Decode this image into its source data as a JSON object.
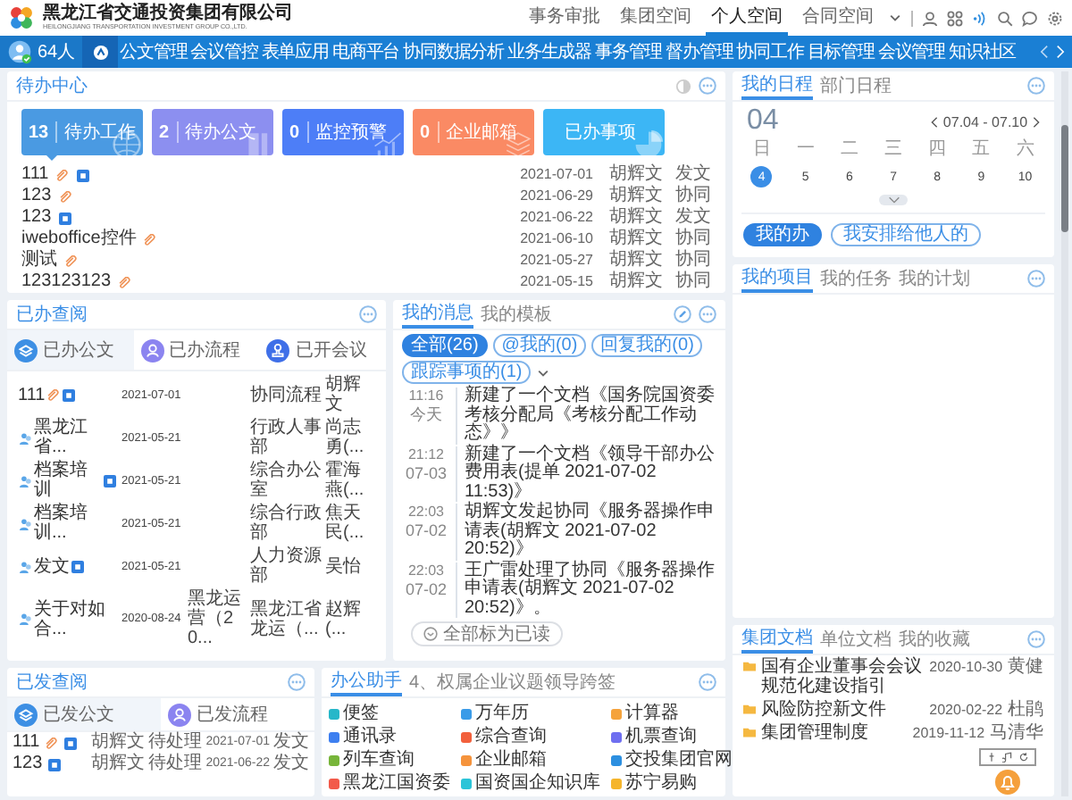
{
  "header": {
    "company": "黑龙江省交通投资集团有限公司",
    "company_en": "HEILONGJIANG TRANSPORTATION INVESTMENT GROUP CO.,LTD.",
    "links": [
      {
        "label": "事务审批",
        "selected": false
      },
      {
        "label": "集团空间",
        "selected": false
      },
      {
        "label": "个人空间",
        "selected": true
      },
      {
        "label": "合同空间",
        "selected": false
      }
    ]
  },
  "nav": {
    "online_count": "64人",
    "items": [
      "公文管理",
      "会议管控",
      "表单应用",
      "电商平台",
      "协同数据分析",
      "业务生成器",
      "事务管理",
      "督办管理",
      "协同工作",
      "目标管理",
      "会议管理",
      "知识社区"
    ]
  },
  "todo": {
    "title": "待办中心",
    "tiles": [
      {
        "count": "13",
        "label": "待办工作",
        "color": "#4a9ae2",
        "selected": true
      },
      {
        "count": "2",
        "label": "待办公文",
        "color": "#8c8ff0",
        "selected": false
      },
      {
        "count": "0",
        "label": "监控预警",
        "color": "#4d7ef7",
        "selected": false
      },
      {
        "count": "0",
        "label": "企业邮箱",
        "color": "#fa8a64",
        "selected": false
      },
      {
        "label": "已办事项",
        "color": "#3cb6f5",
        "selected": false
      }
    ],
    "rows": [
      {
        "title": "111",
        "attachment": true,
        "doc": true,
        "date": "2021-07-01",
        "person": "胡辉文",
        "type": "发文"
      },
      {
        "title": "123",
        "attachment": true,
        "doc": false,
        "date": "2021-06-29",
        "person": "胡辉文",
        "type": "协同"
      },
      {
        "title": "123",
        "attachment": false,
        "doc": true,
        "date": "2021-06-22",
        "person": "胡辉文",
        "type": "发文"
      },
      {
        "title": "iweboffice控件",
        "attachment": true,
        "doc": false,
        "date": "2021-06-10",
        "person": "胡辉文",
        "type": "协同"
      },
      {
        "title": "测试",
        "attachment": true,
        "doc": false,
        "date": "2021-05-27",
        "person": "胡辉文",
        "type": "协同"
      },
      {
        "title": "123123123",
        "attachment": true,
        "doc": false,
        "date": "2021-05-15",
        "person": "胡辉文",
        "type": "协同"
      }
    ]
  },
  "done": {
    "title": "已办查阅",
    "tabs": [
      {
        "label": "已办公文",
        "selected": true
      },
      {
        "label": "已办流程",
        "selected": false
      },
      {
        "label": "已开会议",
        "selected": false
      }
    ],
    "rows": [
      {
        "title": "111",
        "flow": false,
        "attachment": true,
        "doc": true,
        "date": "2021-07-01",
        "dept": "协同流程",
        "person": "胡辉文"
      },
      {
        "title": "黑龙江省...",
        "flow": true,
        "attachment": false,
        "doc": false,
        "date": "2021-05-21",
        "dept": "行政人事部",
        "person": "尚志勇(..."
      },
      {
        "title": "档案培训",
        "flow": true,
        "attachment": false,
        "doc": true,
        "date": "2021-05-21",
        "dept": "综合办公室",
        "person": "霍海燕(..."
      },
      {
        "title": "档案培训...",
        "flow": true,
        "attachment": false,
        "doc": false,
        "date": "2021-05-21",
        "dept": "综合行政部",
        "person": "焦天民(..."
      },
      {
        "title": "发文",
        "flow": true,
        "attachment": false,
        "doc": true,
        "date": "2021-05-21",
        "dept": "人力资源部",
        "person": "吴怡"
      },
      {
        "title": "关于对如合...",
        "flow": true,
        "attachment": false,
        "doc": false,
        "date": "2020-08-24",
        "source": "黑龙运营（20...",
        "dept": "黑龙江省龙运（...",
        "person": "赵辉(..."
      }
    ]
  },
  "messages": {
    "tabs": [
      {
        "label": "我的消息",
        "selected": true
      },
      {
        "label": "我的模板",
        "selected": false
      }
    ],
    "filters": [
      {
        "label": "全部(26)",
        "selected": true
      },
      {
        "label": "@我的(0)",
        "selected": false
      },
      {
        "label": "回复我的(0)",
        "selected": false
      },
      {
        "label": "跟踪事项的(1)",
        "selected": false
      }
    ],
    "items": [
      {
        "time": "11:16",
        "day": "今天",
        "text": "新建了一个文档《国务院国资委考核分配局《考核分配工作动态》》"
      },
      {
        "time": "21:12",
        "day": "07-03",
        "text": "新建了一个文档《领导干部办公费用表(提单 2021-07-02 11:53)》"
      },
      {
        "time": "22:03",
        "day": "07-02",
        "text": "胡辉文发起协同《服务器操作申请表(胡辉文 2021-07-02 20:52)》"
      },
      {
        "time": "22:03",
        "day": "07-02",
        "text": "王广雷处理了协同《服务器操作申请表(胡辉文 2021-07-02 20:52)》。"
      }
    ],
    "mark_all": "全部标为已读"
  },
  "sent": {
    "title": "已发查阅",
    "tabs": [
      {
        "label": "已发公文",
        "selected": true
      },
      {
        "label": "已发流程",
        "selected": false
      }
    ],
    "rows": [
      {
        "title": "111",
        "attachment": true,
        "doc": true,
        "person": "胡辉文",
        "status": "待处理",
        "date": "2021-07-01",
        "type": "发文"
      },
      {
        "title": "123",
        "attachment": false,
        "doc": true,
        "person": "胡辉文",
        "status": "待处理",
        "date": "2021-06-22",
        "type": "发文"
      }
    ]
  },
  "assistant": {
    "tabs": [
      {
        "label": "办公助手",
        "selected": true
      },
      {
        "label": "4、权属企业议题领导跨签",
        "selected": false
      }
    ],
    "tools": [
      {
        "label": "便签",
        "color": "#26b7c9"
      },
      {
        "label": "万年历",
        "color": "#3a9be8"
      },
      {
        "label": "计算器",
        "color": "#f5a33c"
      },
      {
        "label": "通讯录",
        "color": "#3d7ff0"
      },
      {
        "label": "综合查询",
        "color": "#f2603c"
      },
      {
        "label": "机票查询",
        "color": "#6e6ef0"
      },
      {
        "label": "列车查询",
        "color": "#77b53a"
      },
      {
        "label": "企业邮箱",
        "color": "#f5933c"
      },
      {
        "label": "交投集团官网",
        "color": "#2c8fe0"
      },
      {
        "label": "黑龙江国资委",
        "color": "#f25a4a"
      },
      {
        "label": "国资国企知识库",
        "color": "#2bc4d8"
      },
      {
        "label": "苏宁易购",
        "color": "#f5b52c"
      }
    ]
  },
  "schedule": {
    "tabs": [
      {
        "label": "我的日程",
        "selected": true
      },
      {
        "label": "部门日程",
        "selected": false
      }
    ],
    "day": "04",
    "range": "07.04 - 07.10",
    "weekdays": [
      "日",
      "一",
      "二",
      "三",
      "四",
      "五",
      "六"
    ],
    "dates": [
      {
        "label": "4",
        "selected": true
      },
      {
        "label": "5",
        "selected": false
      },
      {
        "label": "6",
        "selected": false
      },
      {
        "label": "7",
        "selected": false
      },
      {
        "label": "8",
        "selected": false
      },
      {
        "label": "9",
        "selected": false
      },
      {
        "label": "10",
        "selected": false
      }
    ],
    "buttons": [
      {
        "label": "我的办",
        "selected": true
      },
      {
        "label": "我安排给他人的",
        "selected": false
      }
    ]
  },
  "projects": {
    "tabs": [
      {
        "label": "我的项目",
        "selected": true
      },
      {
        "label": "我的任务",
        "selected": false
      },
      {
        "label": "我的计划",
        "selected": false
      }
    ]
  },
  "docs": {
    "tabs": [
      {
        "label": "集团文档",
        "selected": true
      },
      {
        "label": "单位文档",
        "selected": false
      },
      {
        "label": "我的收藏",
        "selected": false
      }
    ],
    "rows": [
      {
        "title": "国有企业董事会会议规范化建设指引",
        "date": "2020-10-30",
        "person": "黄健"
      },
      {
        "title": "风险防控新文件",
        "date": "2020-02-22",
        "person": "杜鹃"
      },
      {
        "title": "集团管理制度",
        "date": "2019-11-12",
        "person": "马清华"
      }
    ]
  }
}
